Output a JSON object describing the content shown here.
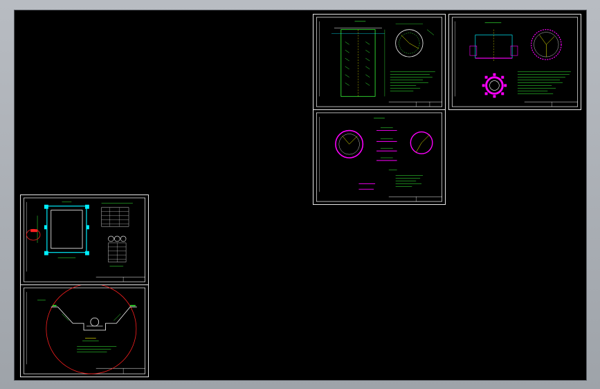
{
  "app": {
    "background_color": "#000000",
    "frame_color": "#a9aeb4",
    "line_colors": {
      "border": "#ffffff",
      "annotation": "#39ff39",
      "magenta": "#ff00ff",
      "cyan": "#00f0ff",
      "red": "#ff2020",
      "yellow": "#ffff00"
    }
  },
  "sheets": [
    {
      "id": "sheet-top-left",
      "icon": "drawing-sheet-icon"
    },
    {
      "id": "sheet-top-right",
      "icon": "drawing-sheet-icon"
    },
    {
      "id": "sheet-middle",
      "icon": "drawing-sheet-icon"
    },
    {
      "id": "sheet-bottom-left-upper",
      "icon": "drawing-sheet-icon"
    },
    {
      "id": "sheet-bottom-left-lower",
      "icon": "drawing-sheet-icon"
    }
  ]
}
